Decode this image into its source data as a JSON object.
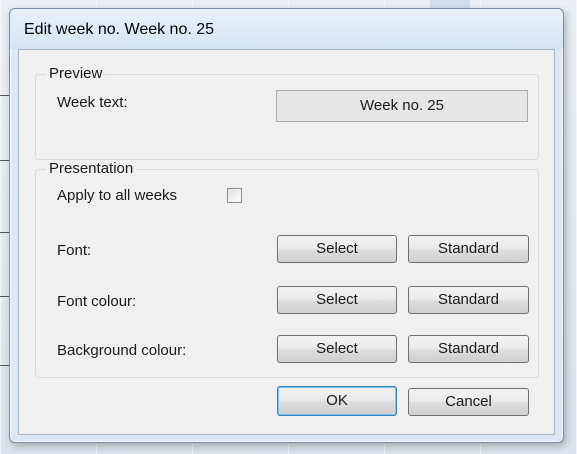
{
  "window": {
    "title": "Edit week no. Week no. 25"
  },
  "preview": {
    "group_label": "Preview",
    "week_text_label": "Week text:",
    "week_text_value": "Week no. 25"
  },
  "presentation": {
    "group_label": "Presentation",
    "apply_all_label": "Apply to all weeks",
    "apply_all_checked": false,
    "rows": [
      {
        "label": "Font:",
        "select_label": "Select",
        "standard_label": "Standard"
      },
      {
        "label": "Font colour:",
        "select_label": "Select",
        "standard_label": "Standard"
      },
      {
        "label": "Background colour:",
        "select_label": "Select",
        "standard_label": "Standard"
      }
    ]
  },
  "footer": {
    "ok_label": "OK",
    "cancel_label": "Cancel"
  }
}
